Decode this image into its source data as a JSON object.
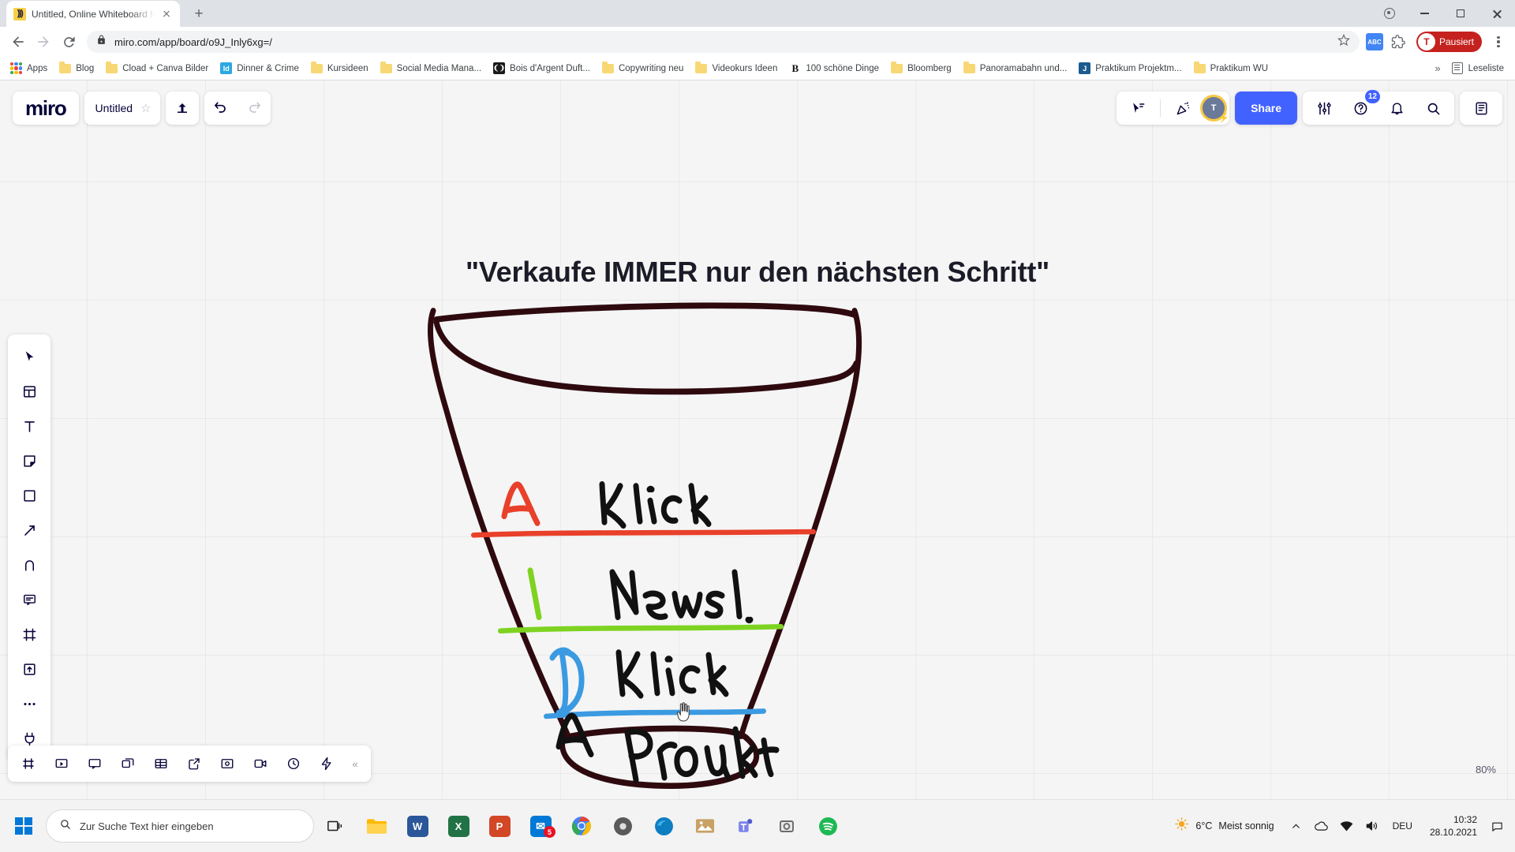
{
  "browser": {
    "tab": {
      "title": "Untitled, Online Whiteboard for",
      "favicon_name": "miro-favicon",
      "close_name": "close-tab"
    },
    "newtab_label": "+",
    "window_controls": {
      "minimize": "–",
      "maximize": "□",
      "close": "✕"
    },
    "nav": {
      "back": "←",
      "forward": "→",
      "reload": "⟳"
    },
    "omnibox": {
      "url": "miro.com/app/board/o9J_Inly6xg=/",
      "lock_icon": "lock-icon",
      "star_icon": "star-icon"
    },
    "profile": {
      "initial": "T",
      "label": "Pausiert",
      "color": "#c5221f"
    },
    "bookmarks": [
      {
        "label": "Apps",
        "icon": "apps-grid-icon"
      },
      {
        "label": "Blog",
        "icon": "folder-icon"
      },
      {
        "label": "Cload + Canva Bilder",
        "icon": "folder-icon"
      },
      {
        "label": "Dinner & Crime",
        "icon": "indesign-icon",
        "icon_text": "Id",
        "icon_color": "#2ba8e0"
      },
      {
        "label": "Kursideen",
        "icon": "folder-icon"
      },
      {
        "label": "Social Media Mana...",
        "icon": "folder-icon"
      },
      {
        "label": "Bois d'Argent Duft...",
        "icon": "dior-icon",
        "icon_text": "()",
        "icon_color": "#1b1b1b"
      },
      {
        "label": "Copywriting neu",
        "icon": "folder-icon"
      },
      {
        "label": "Videokurs Ideen",
        "icon": "folder-icon"
      },
      {
        "label": "100 schöne Dinge",
        "icon": "bold-b-icon",
        "icon_text": "B",
        "icon_color": "#ffffff"
      },
      {
        "label": "Bloomberg",
        "icon": "folder-icon"
      },
      {
        "label": "Panoramabahn und...",
        "icon": "folder-icon"
      },
      {
        "label": "Praktikum Projektm...",
        "icon": "jira-icon",
        "icon_text": "J",
        "icon_color": "#1d5b8f"
      },
      {
        "label": "Praktikum WU",
        "icon": "folder-icon"
      }
    ],
    "bookmarks_overflow": "»",
    "reading_list": {
      "label": "Leseliste",
      "icon": "reading-list-icon"
    }
  },
  "miro": {
    "logo": "miro",
    "board_title": "Untitled",
    "star_icon": "star-outline-icon",
    "header_icons": {
      "upload": "upload-icon",
      "undo": "undo-icon",
      "redo": "redo-icon",
      "present": "present-icon",
      "celebrate": "celebrate-icon",
      "settings": "sliders-icon",
      "help": "help-icon",
      "notifications": "bell-icon",
      "search": "search-icon",
      "panel": "panel-icon"
    },
    "notifications_count": "12",
    "share_label": "Share",
    "user_initial": "T",
    "left_toolbar": [
      {
        "name": "select-tool",
        "icon": "cursor-icon"
      },
      {
        "name": "templates-tool",
        "icon": "templates-icon"
      },
      {
        "name": "text-tool",
        "icon": "text-t-icon"
      },
      {
        "name": "sticky-note-tool",
        "icon": "sticky-note-icon"
      },
      {
        "name": "shape-tool",
        "icon": "square-icon"
      },
      {
        "name": "connector-tool",
        "icon": "arrow-icon"
      },
      {
        "name": "pen-tool",
        "icon": "pen-icon"
      },
      {
        "name": "comment-tool",
        "icon": "comment-icon"
      },
      {
        "name": "frame-tool",
        "icon": "frame-icon"
      },
      {
        "name": "upload-tool",
        "icon": "upload-box-icon"
      },
      {
        "name": "more-tools",
        "icon": "ellipsis-icon"
      },
      {
        "name": "apps-tool",
        "icon": "plugin-icon"
      }
    ],
    "bottom_toolbar": [
      {
        "name": "frames-panel",
        "icon": "frames-icon"
      },
      {
        "name": "presentation-mode",
        "icon": "screen-icon"
      },
      {
        "name": "comments-panel",
        "icon": "chat-icon"
      },
      {
        "name": "cards-panel",
        "icon": "cards-icon"
      },
      {
        "name": "table-panel",
        "icon": "table-icon"
      },
      {
        "name": "export-panel",
        "icon": "export-icon"
      },
      {
        "name": "embed-panel",
        "icon": "embed-icon"
      },
      {
        "name": "video-panel",
        "icon": "video-icon"
      },
      {
        "name": "timer-panel",
        "icon": "timer-icon"
      },
      {
        "name": "automation-panel",
        "icon": "lightning-icon"
      }
    ],
    "collapse_icon": "«",
    "zoom_level": "80%"
  },
  "board": {
    "title": "\"Verkaufe IMMER nur den nächsten Schritt\"",
    "funnel": {
      "outline_color": "#2e0a0f",
      "rows": [
        {
          "letter": "A",
          "letter_color": "#e8402a",
          "label": "Klick",
          "rule_color": "#e8402a"
        },
        {
          "letter": "I",
          "letter_color": "#7ed321",
          "label": "Newsl.",
          "rule_color": "#7ed321"
        },
        {
          "letter": "D",
          "letter_color": "#3b9ae1",
          "label": "Klick",
          "rule_color": "#3b9ae1"
        },
        {
          "letter": "A",
          "letter_color": "#111111",
          "label": "Produkt",
          "rule_color": ""
        }
      ]
    }
  },
  "taskbar": {
    "start_icon": "windows-start-icon",
    "search_placeholder": "Zur Suche Text hier eingeben",
    "search_icon": "search-icon",
    "task_view": "task-view-icon",
    "apps": [
      {
        "name": "file-explorer",
        "label": "",
        "color": "#ffb900"
      },
      {
        "name": "word",
        "label": "W",
        "color": "#2b579a"
      },
      {
        "name": "excel",
        "label": "X",
        "color": "#217346"
      },
      {
        "name": "powerpoint",
        "label": "P",
        "color": "#d24726"
      },
      {
        "name": "mail",
        "label": "✉",
        "color": "#0078d7",
        "badge": "5"
      },
      {
        "name": "chrome",
        "label": "",
        "color": "#4285f4"
      },
      {
        "name": "media-player",
        "label": "",
        "color": "#5a5a5a"
      },
      {
        "name": "edge",
        "label": "",
        "color": "#0d7ec0"
      },
      {
        "name": "photos",
        "label": "",
        "color": "#c8a165"
      },
      {
        "name": "teams",
        "label": "",
        "color": "#5059c9"
      },
      {
        "name": "screenshot-tool",
        "label": "",
        "color": "#7a7a7a"
      },
      {
        "name": "spotify",
        "label": "",
        "color": "#1db954"
      }
    ],
    "weather": {
      "temp": "6°C",
      "desc": "Meist sonnig",
      "icon": "sun-icon"
    },
    "tray_icons": [
      "chevron-up-icon",
      "onedrive-icon",
      "network-icon",
      "volume-icon"
    ],
    "language": "DEU",
    "clock": {
      "time": "10:32",
      "date": "28.10.2021"
    },
    "notification_icon": "notification-icon"
  }
}
